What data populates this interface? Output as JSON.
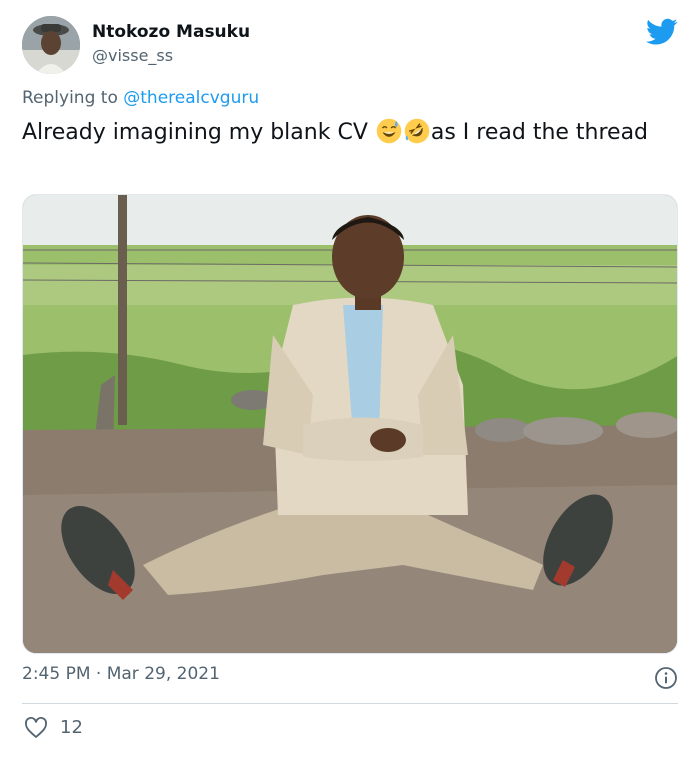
{
  "author": {
    "name": "Ntokozo Masuku",
    "handle": "@visse_ss",
    "avatar_icon": "profile-photo"
  },
  "reply": {
    "prefix": "Replying to ",
    "mention": "@therealcvguru"
  },
  "tweet": {
    "text_before": "Already imagining my blank CV ",
    "text_after": "as I read the thread",
    "emojis": [
      "grinning-face-with-sweat",
      "rolling-on-floor-laughing"
    ]
  },
  "media": {
    "description_icon": "photo"
  },
  "timestamp": {
    "time": "2:45 PM",
    "separator": " · ",
    "date": "Mar 29, 2021"
  },
  "actions": {
    "likes": "12"
  },
  "colors": {
    "brand": "#1d9bf0",
    "secondary_text": "#536471",
    "primary_text": "#0f1419"
  }
}
